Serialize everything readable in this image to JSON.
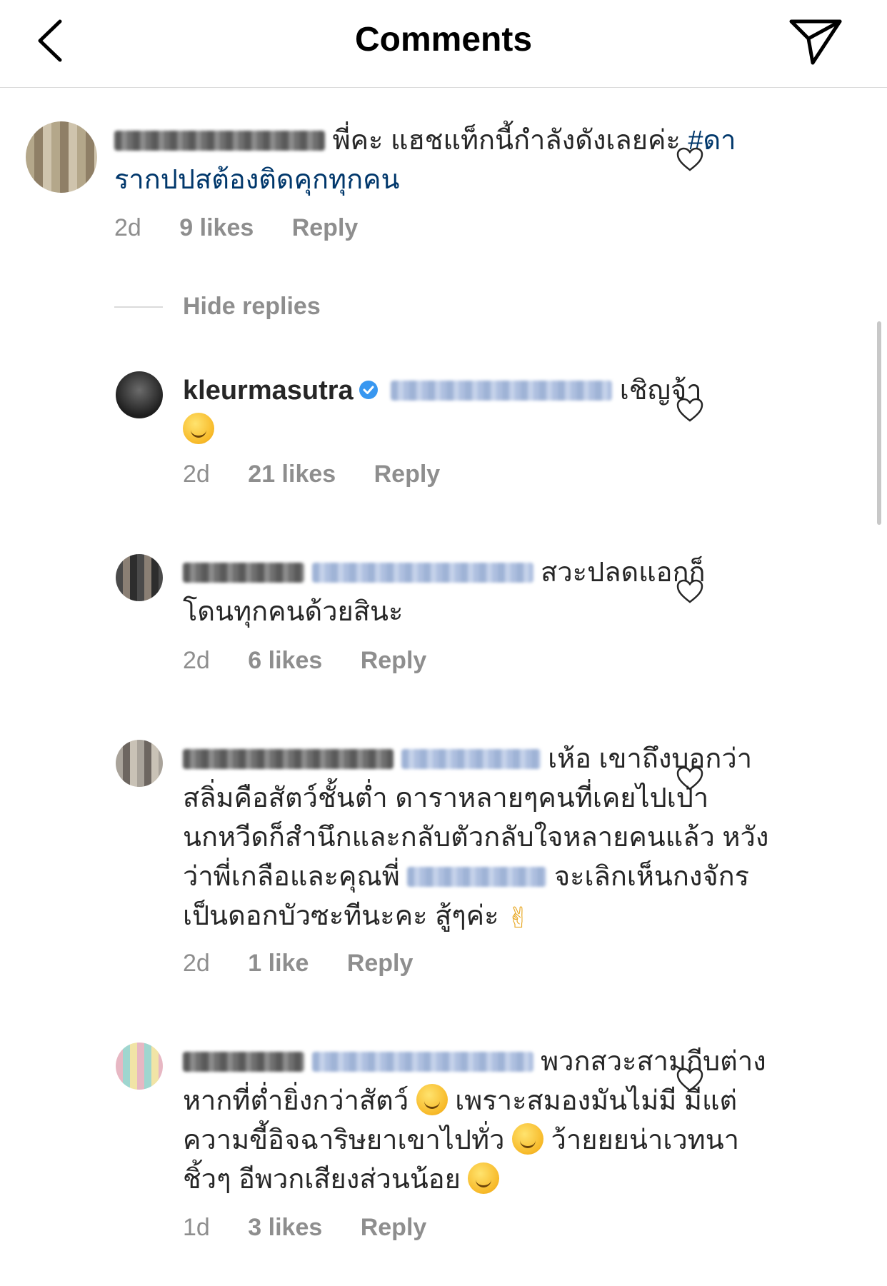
{
  "header": {
    "title": "Comments",
    "back_icon": "chevron-left-icon",
    "send_icon": "paper-plane-icon"
  },
  "hide_replies_label": "Hide replies",
  "comments": [
    {
      "text": "พี่คะ แฮชแท็กนี้กำลังดังเลยค่ะ ",
      "hashtag": "#ดารากปปสต้องติดคุกทุกคน",
      "time": "2d",
      "likes": "9 likes",
      "reply": "Reply"
    },
    {
      "username": "kleurmasutra",
      "text": "เชิญจ้า",
      "time": "2d",
      "likes": "21 likes",
      "reply": "Reply"
    },
    {
      "text": "สวะปลดแอกก็โดนทุกคนด้วยสินะ",
      "time": "2d",
      "likes": "6 likes",
      "reply": "Reply"
    },
    {
      "text_a": "เห้อ เขาถึงบอกว่าสลิ่มคือสัตว์ชั้นต่ำ ดาราหลายๆคนที่เคยไปเป่านกหวีดก็สำนึกและกลับตัวกลับใจหลายคนแล้ว หวังว่าพี่เกลือและคุณพี่",
      "text_b": "จะเลิกเห็นกงจักรเป็นดอกบัวซะทีนะคะ สู้ๆค่ะ",
      "time": "2d",
      "likes": "1 like",
      "reply": "Reply"
    },
    {
      "text_a": "พวกสวะสามกีบต่างหากที่ต่ำยิ่งกว่าสัตว์",
      "text_b": "เพราะสมองมันไม่มี มีแต่ความขี้อิจฉาริษยาเขาไปทั่ว",
      "text_c": "ว้ายยยน่าเวทนา ชิ้วๆ อีพวกเสียงส่วนน้อย",
      "time": "1d",
      "likes": "3 likes",
      "reply": "Reply"
    }
  ],
  "colors": {
    "hashtag": "#00376b",
    "meta": "#8e8e8e",
    "verified": "#3897f0"
  }
}
